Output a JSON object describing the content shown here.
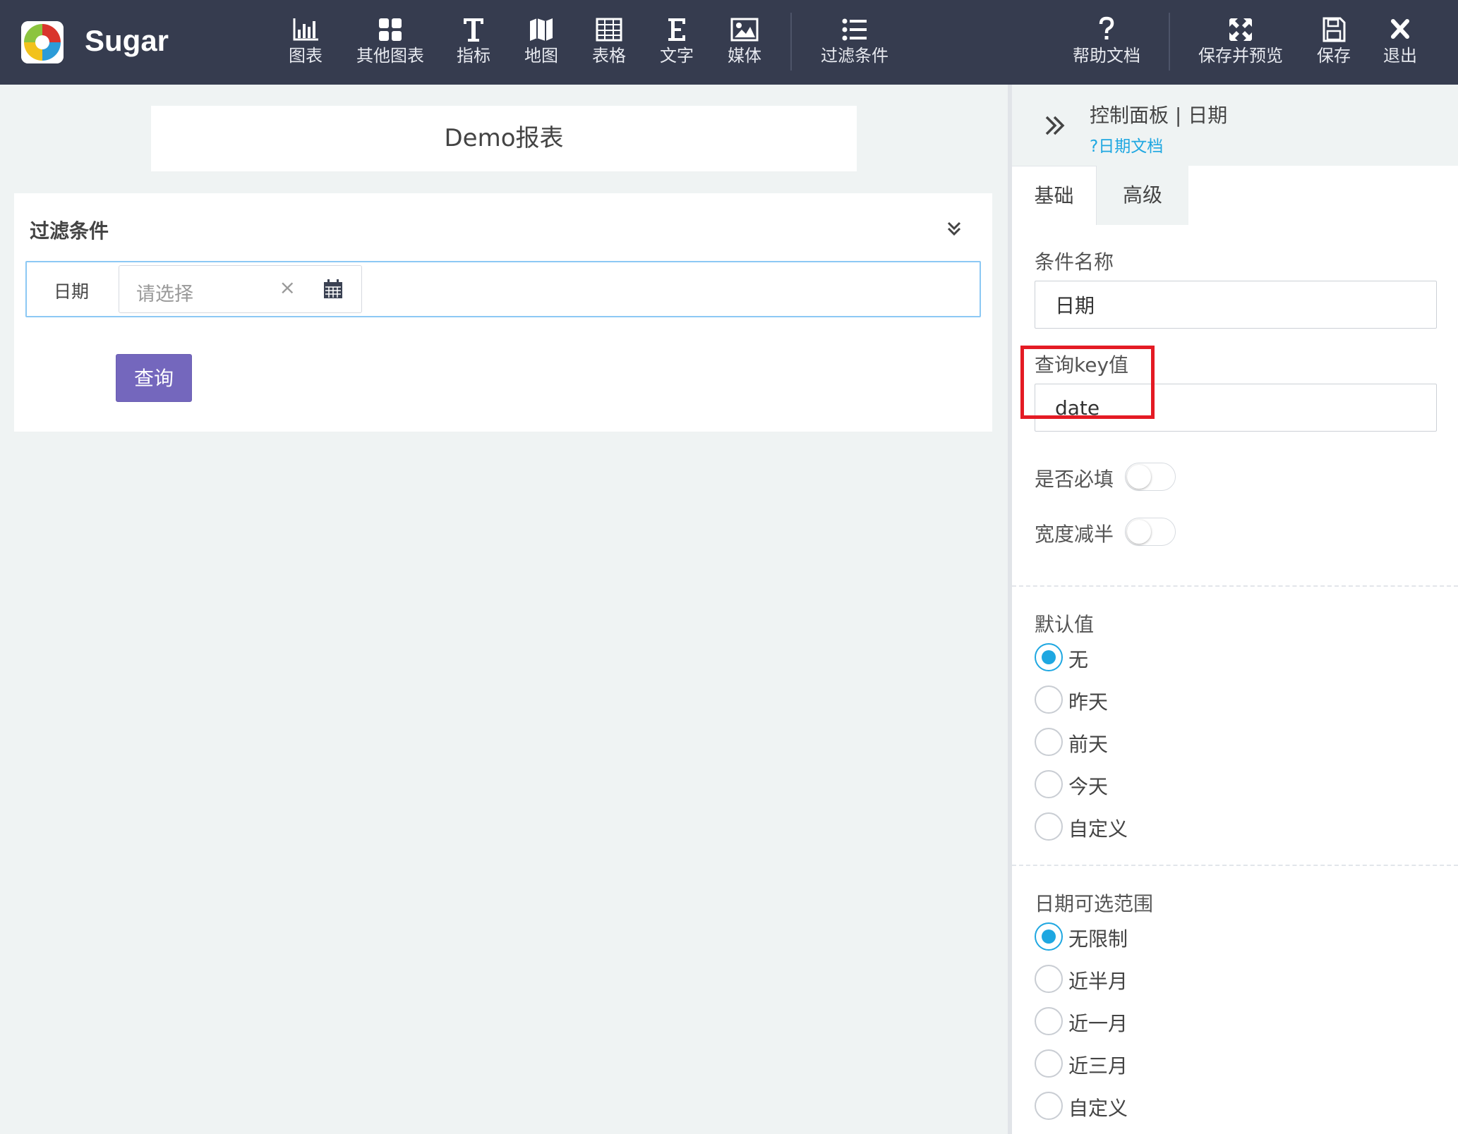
{
  "app": {
    "name": "Sugar"
  },
  "toolbar": {
    "items": [
      {
        "label": "图表",
        "icon": "bar-chart-icon"
      },
      {
        "label": "其他图表",
        "icon": "grid-icon"
      },
      {
        "label": "指标",
        "icon": "text-t-icon"
      },
      {
        "label": "地图",
        "icon": "map-icon"
      },
      {
        "label": "表格",
        "icon": "table-icon"
      },
      {
        "label": "文字",
        "icon": "text-e-icon"
      },
      {
        "label": "媒体",
        "icon": "image-icon"
      },
      {
        "label": "过滤条件",
        "icon": "list-icon"
      }
    ],
    "right_items": [
      {
        "label": "帮助文档",
        "icon": "question-icon"
      },
      {
        "label": "保存并预览",
        "icon": "expand-arrows-icon"
      },
      {
        "label": "保存",
        "icon": "floppy-icon"
      },
      {
        "label": "退出",
        "icon": "close-icon"
      }
    ]
  },
  "canvas": {
    "report_title": "Demo报表",
    "filter": {
      "title": "过滤条件",
      "date_label": "日期",
      "date_placeholder": "请选择",
      "clear_symbol": "×",
      "query_button": "查询"
    }
  },
  "panel": {
    "title": "控制面板 | 日期",
    "doc_link": "?日期文档",
    "tabs": [
      "基础",
      "高级"
    ],
    "condition_name_label": "条件名称",
    "condition_name_value": "日期",
    "query_key_label": "查询key值",
    "query_key_value": "date",
    "required_label": "是否必填",
    "required_on": false,
    "half_width_label": "宽度减半",
    "half_width_on": false,
    "default_value_label": "默认值",
    "default_options": [
      "无",
      "昨天",
      "前天",
      "今天",
      "自定义"
    ],
    "default_selected": "无",
    "range_label": "日期可选范围",
    "range_options": [
      "无限制",
      "近半月",
      "近一月",
      "近三月",
      "自定义"
    ],
    "range_selected": "无限制"
  },
  "colors": {
    "topbar": "#363c4f",
    "accent_blue": "#1ea7e1",
    "query_button": "#7467bd",
    "highlight": "#e41b24"
  }
}
